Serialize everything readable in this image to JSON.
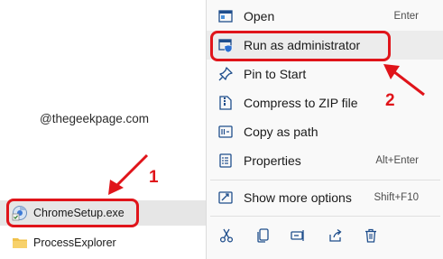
{
  "watermark": "@thegeekpage.com",
  "files": [
    {
      "name": "ChromeSetup.exe",
      "icon": "chrome-setup-icon",
      "selected": true
    },
    {
      "name": "ProcessExplorer",
      "icon": "folder-icon",
      "selected": false
    }
  ],
  "menu": {
    "items": [
      {
        "label": "Open",
        "shortcut": "Enter",
        "icon": "open-window-icon"
      },
      {
        "label": "Run as administrator",
        "shortcut": "",
        "icon": "shield-admin-icon"
      },
      {
        "label": "Pin to Start",
        "shortcut": "",
        "icon": "pin-icon"
      },
      {
        "label": "Compress to ZIP file",
        "shortcut": "",
        "icon": "zip-icon"
      },
      {
        "label": "Copy as path",
        "shortcut": "",
        "icon": "copy-path-icon"
      },
      {
        "label": "Properties",
        "shortcut": "Alt+Enter",
        "icon": "properties-icon"
      },
      {
        "label": "Show more options",
        "shortcut": "Shift+F10",
        "icon": "more-options-icon"
      }
    ],
    "toolbar": [
      "cut-icon",
      "copy-icon",
      "rename-icon",
      "share-icon",
      "delete-icon"
    ]
  },
  "annotations": {
    "step1": "1",
    "step2": "2"
  },
  "colors": {
    "accent": "#0067c0",
    "annotation": "#e0141a",
    "selected_row": "#e6e6e6"
  }
}
